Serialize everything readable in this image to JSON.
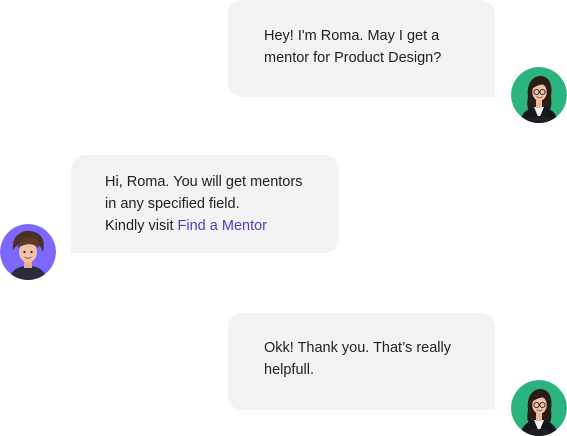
{
  "colors": {
    "bubble_bg": "#f3f3f3",
    "text": "#1f1f1f",
    "link": "#4e3fbd",
    "user_avatar_bg": "#2bb47e",
    "mentor_avatar_bg": "#7c67ff"
  },
  "messages": [
    {
      "sender": "user",
      "avatar": "woman-avatar-icon",
      "lines": [
        "Hey! I'm Roma. May I get a",
        "mentor for Product Design?"
      ]
    },
    {
      "sender": "mentor",
      "avatar": "man-avatar-icon",
      "lines": [
        "Hi, Roma. You will get mentors",
        "in any specified field."
      ],
      "prefix": "Kindly visit ",
      "link": "Find a Mentor"
    },
    {
      "sender": "user",
      "avatar": "woman-avatar-icon",
      "lines": [
        "Okk! Thank you. That’s really",
        "helpfull."
      ]
    }
  ]
}
